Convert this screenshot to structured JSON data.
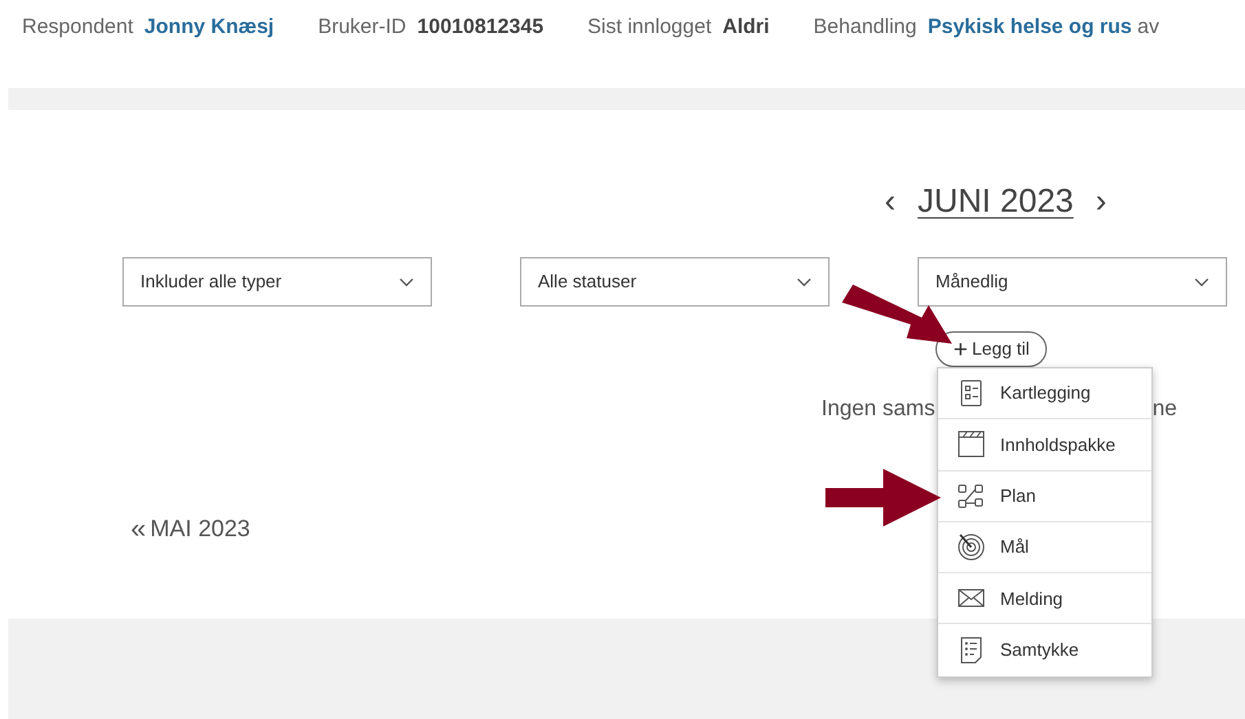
{
  "header": [
    {
      "label": "Respondent",
      "value": "Jonny Knæsj",
      "link": true
    },
    {
      "label": "Bruker-ID",
      "value": "10010812345",
      "link": false
    },
    {
      "label": "Sist innlogget",
      "value": "Aldri",
      "link": false
    },
    {
      "label": "Behandling",
      "value": "Psykisk helse og rus",
      "link": true,
      "trailing": "av"
    }
  ],
  "month_nav": {
    "prev": "‹",
    "title": "JUNI 2023",
    "next": "›"
  },
  "filters": [
    "Inkluder alle typer",
    "Alle statuser",
    "Månedlig"
  ],
  "add_button": {
    "icon": "+",
    "label": "Legg til"
  },
  "empty_message": [
    "Ingen sams",
    "ne"
  ],
  "previous_month": {
    "icon": "«",
    "label": "MAI 2023"
  },
  "add_menu": [
    "Kartlegging",
    "Innholdspakke",
    "Plan",
    "Mål",
    "Melding",
    "Samtykke"
  ]
}
